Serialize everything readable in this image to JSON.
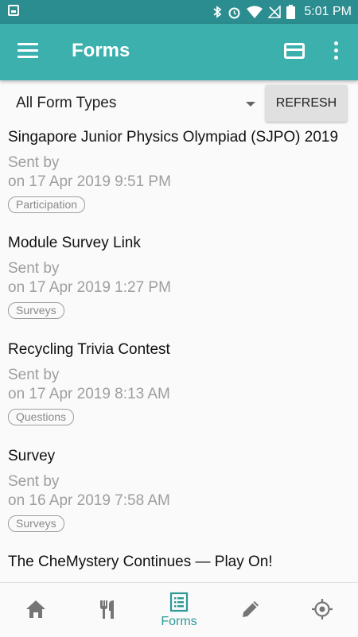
{
  "status_bar": {
    "time": "5:01 PM"
  },
  "app_bar": {
    "title": "Forms"
  },
  "filter": {
    "selected": "All Form Types",
    "refresh_label": "REFRESH"
  },
  "forms": [
    {
      "title": "Singapore Junior Physics Olympiad (SJPO) 2019",
      "sent_by": "Sent by",
      "date": "on 17 Apr 2019 9:51 PM",
      "tag": "Participation"
    },
    {
      "title": "Module Survey Link",
      "sent_by": "Sent by",
      "date": "on 17 Apr 2019 1:27 PM",
      "tag": "Surveys"
    },
    {
      "title": "Recycling Trivia Contest",
      "sent_by": "Sent by",
      "date": "on 17 Apr 2019 8:13 AM",
      "tag": "Questions"
    },
    {
      "title": "Survey",
      "sent_by": "Sent by",
      "date": "on 16 Apr 2019 7:58 AM",
      "tag": "Surveys"
    },
    {
      "title": "The CheMystery Continues — Play On!",
      "sent_by": "",
      "date": "",
      "tag": ""
    }
  ],
  "bottom_nav": {
    "items": [
      {
        "icon": "home-icon"
      },
      {
        "icon": "utensils-icon"
      },
      {
        "icon": "forms-icon",
        "label": "Forms",
        "active": true
      },
      {
        "icon": "pencil-icon"
      },
      {
        "icon": "location-target-icon"
      }
    ],
    "accent": "#2b9a98"
  },
  "colors": {
    "primary": "#3bb0ad",
    "status_bar": "#2b8d8f",
    "tag_border": "#9e9e9e"
  }
}
